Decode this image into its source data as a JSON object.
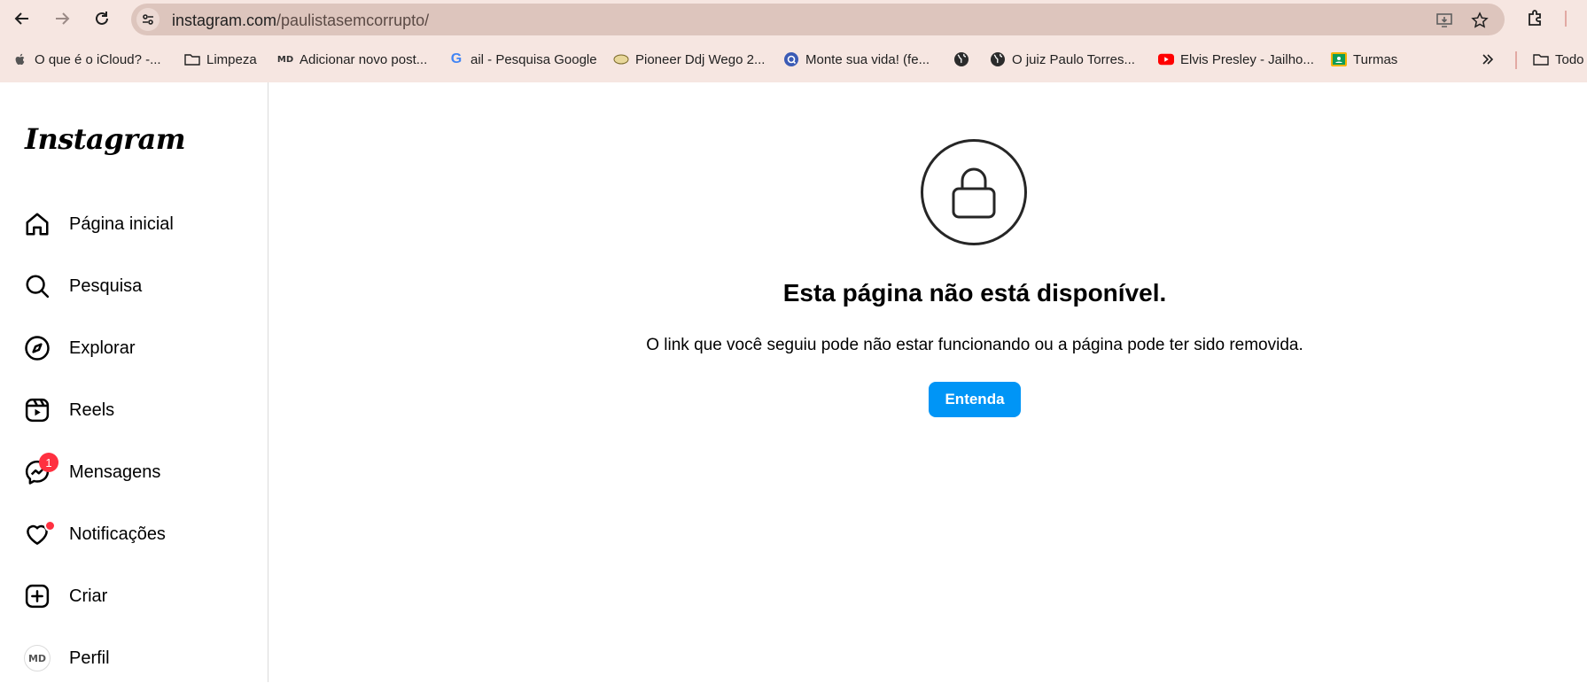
{
  "browser": {
    "url_host": "instagram.com",
    "url_path": "/paulistasemcorrupto/",
    "bookmarks": [
      {
        "label": "O que é o iCloud? -...",
        "icon": "apple-icon"
      },
      {
        "label": "Limpeza",
        "icon": "folder-icon"
      },
      {
        "label": "Adicionar novo post...",
        "icon": "md-icon"
      },
      {
        "label": "ail - Pesquisa Google",
        "icon": "google-icon"
      },
      {
        "label": "Pioneer Ddj Wego 2...",
        "icon": "pioneer-icon"
      },
      {
        "label": "Monte sua vida! (fe...",
        "icon": "q-icon"
      },
      {
        "label": "",
        "icon": "globe-icon"
      },
      {
        "label": "O juiz Paulo Torres...",
        "icon": "globe-icon"
      },
      {
        "label": "Elvis Presley - Jailho...",
        "icon": "youtube-icon"
      },
      {
        "label": "Turmas",
        "icon": "classroom-icon"
      }
    ],
    "other_bookmarks_label": "Todo",
    "colors": {
      "chrome": "#f6e6e1",
      "omnibox": "#ddc5bd"
    }
  },
  "sidebar": {
    "logo": "Instagram",
    "items": [
      {
        "label": "Página inicial",
        "icon": "home-icon"
      },
      {
        "label": "Pesquisa",
        "icon": "search-icon"
      },
      {
        "label": "Explorar",
        "icon": "compass-icon"
      },
      {
        "label": "Reels",
        "icon": "reels-icon"
      },
      {
        "label": "Mensagens",
        "icon": "messenger-icon",
        "badge": "1"
      },
      {
        "label": "Notificações",
        "icon": "heart-icon",
        "dot": true
      },
      {
        "label": "Criar",
        "icon": "create-icon"
      },
      {
        "label": "Perfil",
        "icon": "avatar",
        "avatar_text": "MD"
      }
    ]
  },
  "main": {
    "title": "Esta página não está disponível.",
    "description": "O link que você seguiu pode não estar funcionando ou a página pode ter sido removida.",
    "button_label": "Entenda",
    "accent": "#0095f6"
  }
}
